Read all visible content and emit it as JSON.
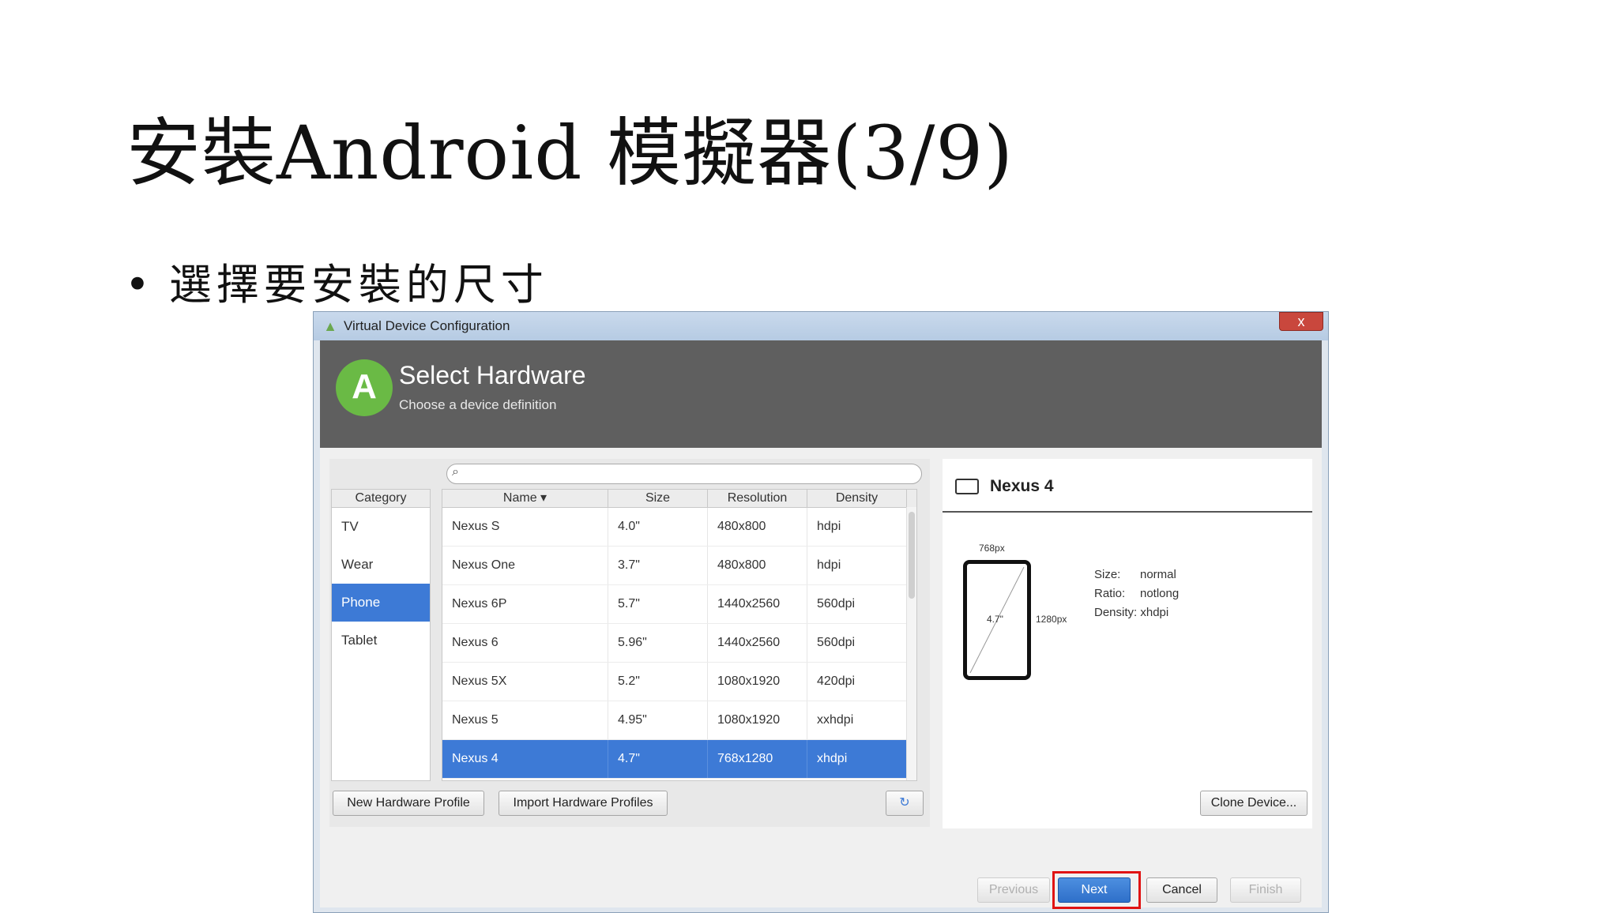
{
  "slide": {
    "title": "安裝Android 模擬器(3/9)",
    "bullet_marker": "•",
    "bullet": "選擇要安裝的尺寸"
  },
  "window": {
    "title": "Virtual Device Configuration",
    "close_label": "x",
    "header_title": "Select Hardware",
    "header_subtitle": "Choose a device definition"
  },
  "categories": {
    "header": "Category",
    "items": [
      "TV",
      "Wear",
      "Phone",
      "Tablet"
    ],
    "selected": "Phone"
  },
  "table": {
    "columns": [
      "Name ▾",
      "Size",
      "Resolution",
      "Density"
    ],
    "rows": [
      [
        "Nexus S",
        "4.0\"",
        "480x800",
        "hdpi"
      ],
      [
        "Nexus One",
        "3.7\"",
        "480x800",
        "hdpi"
      ],
      [
        "Nexus 6P",
        "5.7\"",
        "1440x2560",
        "560dpi"
      ],
      [
        "Nexus 6",
        "5.96\"",
        "1440x2560",
        "560dpi"
      ],
      [
        "Nexus 5X",
        "5.2\"",
        "1080x1920",
        "420dpi"
      ],
      [
        "Nexus 5",
        "4.95\"",
        "1080x1920",
        "xxhdpi"
      ],
      [
        "Nexus 4",
        "4.7\"",
        "768x1280",
        "xhdpi"
      ]
    ],
    "selected_row": 6
  },
  "left_buttons": {
    "new_profile": "New Hardware Profile",
    "import_profiles": "Import Hardware Profiles"
  },
  "preview": {
    "device_name": "Nexus 4",
    "width_label": "768px",
    "height_label": "1280px",
    "diagonal_label": "4.7\"",
    "size_key": "Size:",
    "size_val": "normal",
    "ratio_key": "Ratio:",
    "ratio_val": "notlong",
    "density_key": "Density:",
    "density_val": "xhdpi",
    "clone_button": "Clone Device..."
  },
  "footer": {
    "previous": "Previous",
    "next": "Next",
    "cancel": "Cancel",
    "finish": "Finish"
  },
  "colors": {
    "selection": "#3d7ad6",
    "header_band": "#5f5f5f",
    "highlight_box": "#e01313"
  }
}
